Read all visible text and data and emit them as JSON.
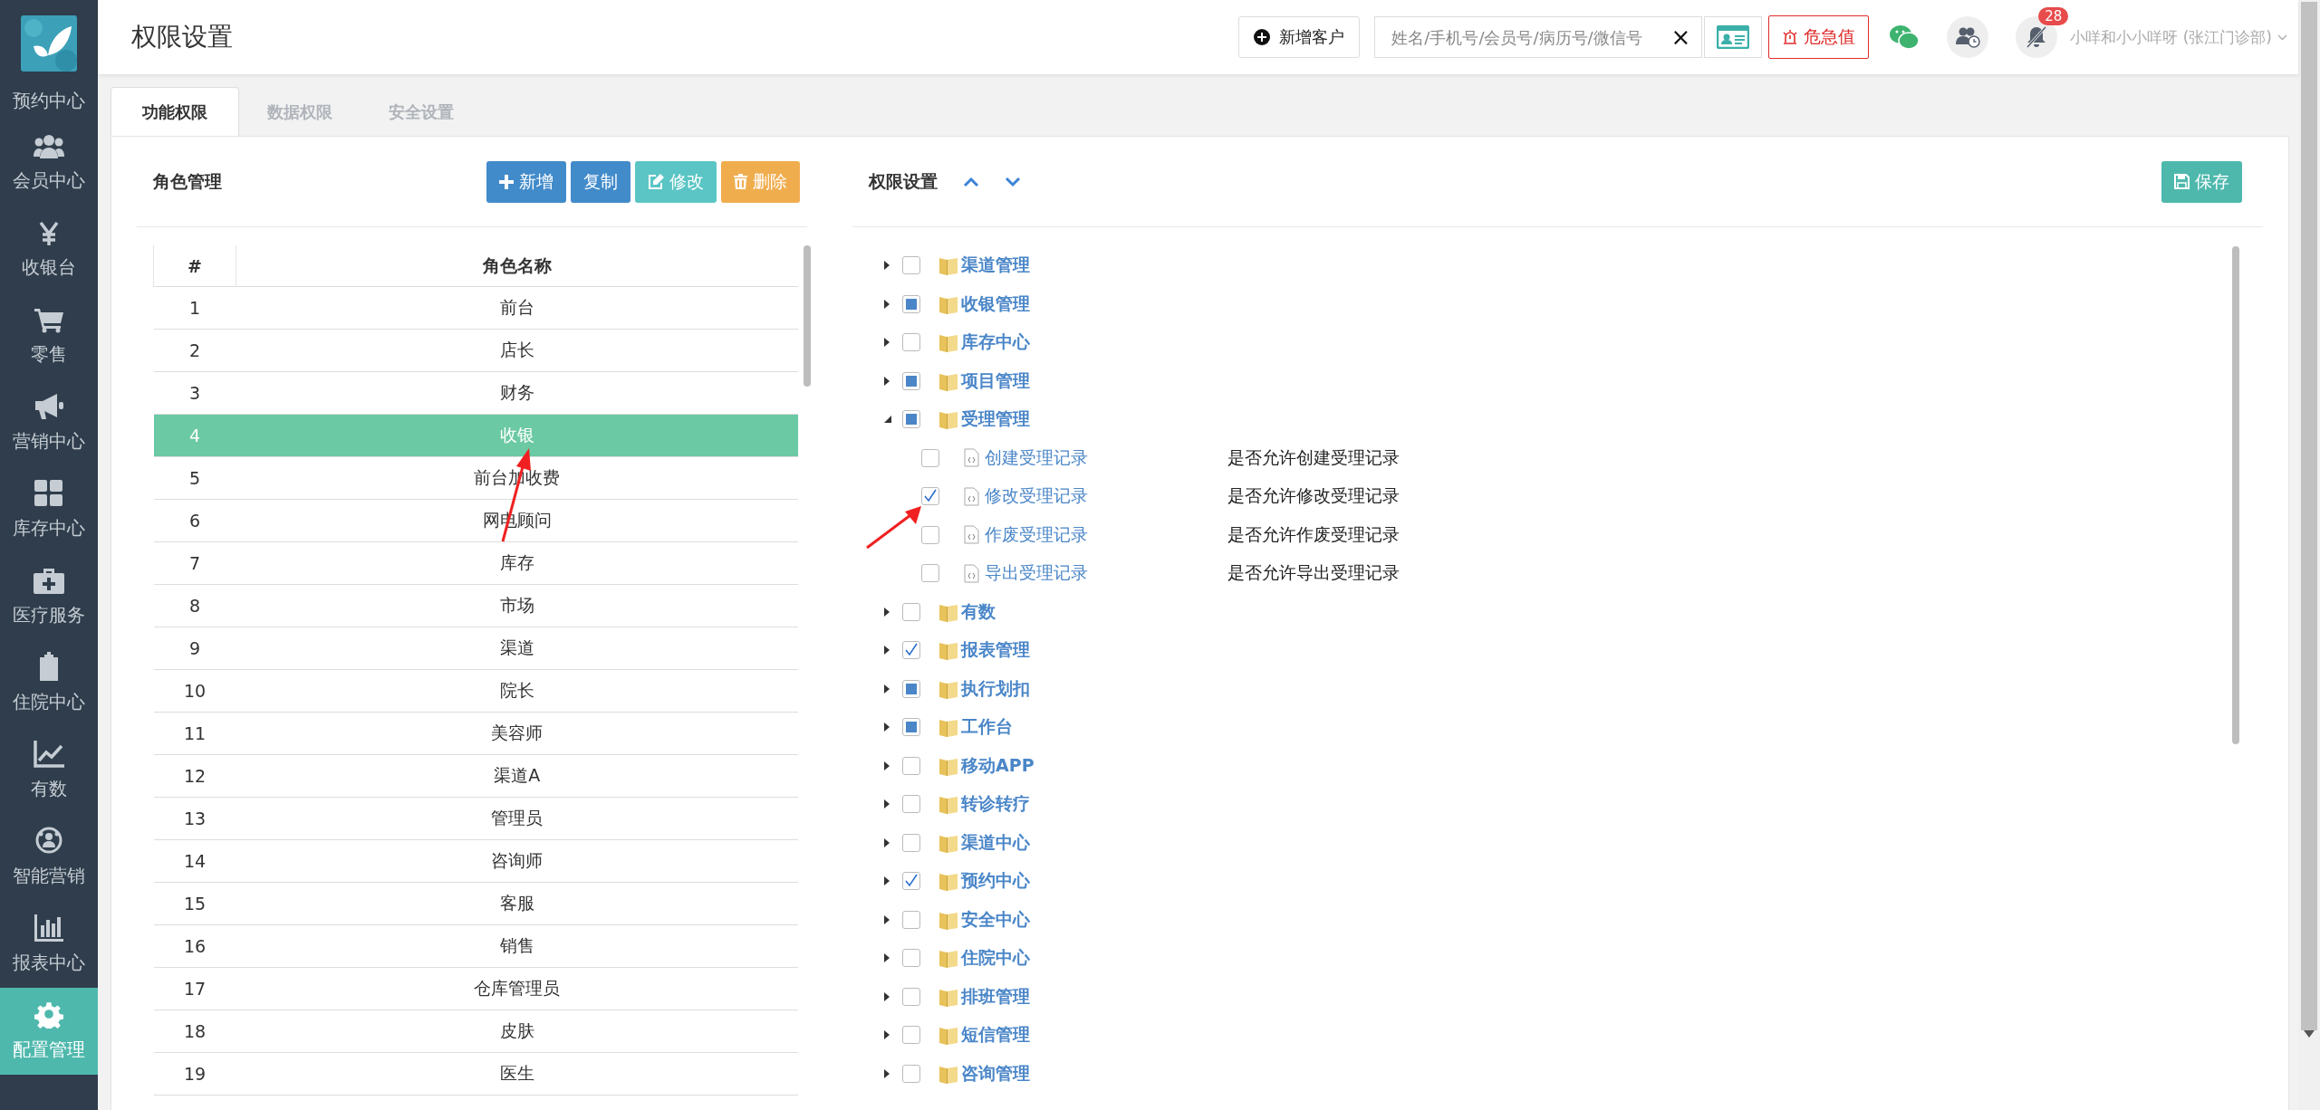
{
  "sidebar": {
    "items": [
      {
        "label": "预约中心",
        "selected": false
      },
      {
        "label": "会员中心",
        "selected": false
      },
      {
        "label": "收银台",
        "selected": false
      },
      {
        "label": "零售",
        "selected": false
      },
      {
        "label": "营销中心",
        "selected": false
      },
      {
        "label": "库存中心",
        "selected": false
      },
      {
        "label": "医疗服务",
        "selected": false
      },
      {
        "label": "住院中心",
        "selected": false
      },
      {
        "label": "有数",
        "selected": false
      },
      {
        "label": "智能营销",
        "selected": false
      },
      {
        "label": "报表中心",
        "selected": false
      },
      {
        "label": "配置管理",
        "selected": true
      }
    ]
  },
  "header": {
    "title": "权限设置",
    "new_customer_button": "新增客户",
    "search": {
      "placeholder": "姓名/手机号/会员号/病历号/微信号",
      "clear": "×"
    },
    "alert_button": "危急值",
    "notification_count": "28",
    "user": "小咩和小小咩呀 (张江门诊部)"
  },
  "tabs": [
    {
      "label": "功能权限",
      "selected": true
    },
    {
      "label": "数据权限",
      "selected": false
    },
    {
      "label": "安全设置",
      "selected": false
    }
  ],
  "roles": {
    "title": "角色管理",
    "buttons": [
      {
        "label": "新增",
        "kind": "add"
      },
      {
        "label": "复制",
        "kind": "copy"
      },
      {
        "label": "修改",
        "kind": "edit"
      },
      {
        "label": "删除",
        "kind": "delete"
      }
    ],
    "columns": [
      "#",
      "角色名称"
    ],
    "rows": [
      {
        "index": "1",
        "name": "前台",
        "selected": false
      },
      {
        "index": "2",
        "name": "店长",
        "selected": false
      },
      {
        "index": "3",
        "name": "财务",
        "selected": false
      },
      {
        "index": "4",
        "name": "收银",
        "selected": true
      },
      {
        "index": "5",
        "name": "前台加收费",
        "selected": false
      },
      {
        "index": "6",
        "name": "网电顾问",
        "selected": false
      },
      {
        "index": "7",
        "name": "库存",
        "selected": false
      },
      {
        "index": "8",
        "name": "市场",
        "selected": false
      },
      {
        "index": "9",
        "name": "渠道",
        "selected": false
      },
      {
        "index": "10",
        "name": "院长",
        "selected": false
      },
      {
        "index": "11",
        "name": "美容师",
        "selected": false
      },
      {
        "index": "12",
        "name": "渠道A",
        "selected": false
      },
      {
        "index": "13",
        "name": "管理员",
        "selected": false
      },
      {
        "index": "14",
        "name": "咨询师",
        "selected": false
      },
      {
        "index": "15",
        "name": "客服",
        "selected": false
      },
      {
        "index": "16",
        "name": "销售",
        "selected": false
      },
      {
        "index": "17",
        "name": "仓库管理员",
        "selected": false
      },
      {
        "index": "18",
        "name": "皮肤",
        "selected": false
      },
      {
        "index": "19",
        "name": "医生",
        "selected": false
      }
    ]
  },
  "permissions": {
    "title": "权限设置",
    "save_button": "保存",
    "tree": [
      {
        "label": "渠道管理",
        "checked": false,
        "partial": false,
        "expanded": false
      },
      {
        "label": "收银管理",
        "checked": false,
        "partial": true,
        "expanded": false
      },
      {
        "label": "库存中心",
        "checked": false,
        "partial": false,
        "expanded": false
      },
      {
        "label": "项目管理",
        "checked": false,
        "partial": true,
        "expanded": false
      },
      {
        "label": "受理管理",
        "checked": false,
        "partial": true,
        "expanded": true,
        "children": [
          {
            "label": "创建受理记录",
            "description": "是否允许创建受理记录",
            "checked": false
          },
          {
            "label": "修改受理记录",
            "description": "是否允许修改受理记录",
            "checked": true
          },
          {
            "label": "作废受理记录",
            "description": "是否允许作废受理记录",
            "checked": false
          },
          {
            "label": "导出受理记录",
            "description": "是否允许导出受理记录",
            "checked": false
          }
        ]
      },
      {
        "label": "有数",
        "checked": false,
        "partial": false,
        "expanded": false
      },
      {
        "label": "报表管理",
        "checked": true,
        "partial": false,
        "expanded": false
      },
      {
        "label": "执行划扣",
        "checked": false,
        "partial": true,
        "expanded": false
      },
      {
        "label": "工作台",
        "checked": false,
        "partial": true,
        "expanded": false
      },
      {
        "label": "移动APP",
        "checked": false,
        "partial": false,
        "expanded": false
      },
      {
        "label": "转诊转疗",
        "checked": false,
        "partial": false,
        "expanded": false
      },
      {
        "label": "渠道中心",
        "checked": false,
        "partial": false,
        "expanded": false
      },
      {
        "label": "预约中心",
        "checked": true,
        "partial": false,
        "expanded": false
      },
      {
        "label": "安全中心",
        "checked": false,
        "partial": false,
        "expanded": false
      },
      {
        "label": "住院中心",
        "checked": false,
        "partial": false,
        "expanded": false
      },
      {
        "label": "排班管理",
        "checked": false,
        "partial": false,
        "expanded": false
      },
      {
        "label": "短信管理",
        "checked": false,
        "partial": false,
        "expanded": false
      },
      {
        "label": "咨询管理",
        "checked": false,
        "partial": false,
        "expanded": false
      }
    ]
  }
}
